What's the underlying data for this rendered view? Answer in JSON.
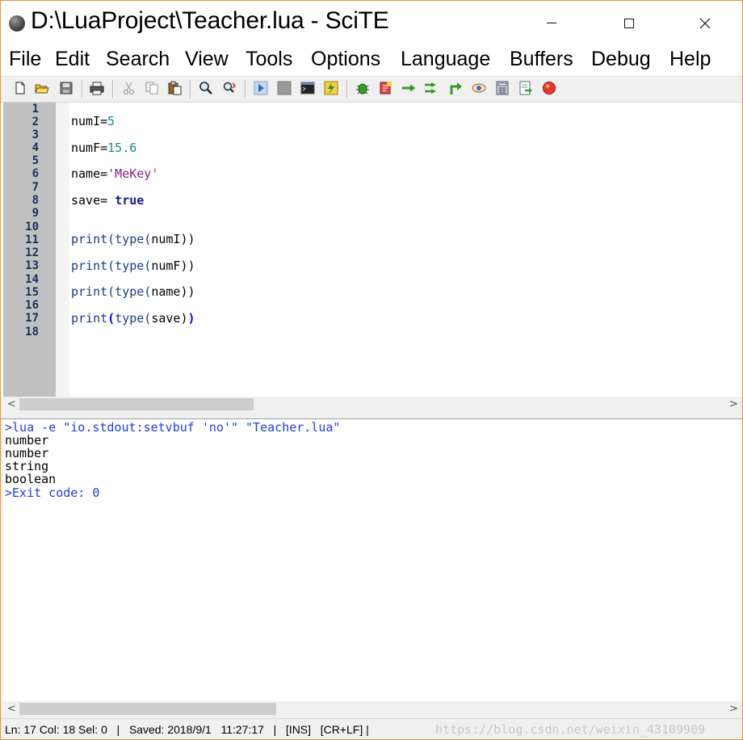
{
  "window": {
    "title": "D:\\LuaProject\\Teacher.lua - SciTE",
    "minimize_glyph": "",
    "close_glyph": "✕"
  },
  "menu": [
    "File",
    "Edit",
    "Search",
    "View",
    "Tools",
    "Options",
    "Language",
    "Buffers",
    "Debug",
    "Help"
  ],
  "toolbar_icons": [
    "new-file-icon",
    "open-folder-icon",
    "save-icon",
    "print-icon",
    "cut-icon",
    "copy-icon",
    "paste-icon",
    "find-icon",
    "replace-icon",
    "run-icon",
    "stop-icon",
    "console-icon",
    "build-icon",
    "debug-bug-icon",
    "debug-step-icon",
    "step-over-icon",
    "step-into-icon",
    "step-out-icon",
    "watch-icon",
    "calculator-icon",
    "export-icon",
    "breakpoint-icon"
  ],
  "editor": {
    "line_numbers": [
      "1",
      "2",
      "3",
      "4",
      "5",
      "6",
      "7",
      "8",
      "9",
      "10",
      "11",
      "12",
      "13",
      "14",
      "15",
      "16",
      "17",
      "18"
    ],
    "code": {
      "l2": {
        "var": "numI=",
        "val": "5"
      },
      "l4": {
        "var": "numF=",
        "val": "15.6"
      },
      "l6": {
        "var": "name=",
        "val": "'MeKey'"
      },
      "l8": {
        "var": "save= ",
        "val": "true"
      },
      "l11": {
        "fn": "print(type(",
        "arg": "numI",
        "close": "))"
      },
      "l13": {
        "fn": "print(type(",
        "arg": "numF",
        "close": "))"
      },
      "l15": {
        "fn": "print(type(",
        "arg": "name",
        "close": "))"
      },
      "l17": {
        "fn": "print",
        "open": "(",
        "fn2": "type(",
        "arg": "save",
        "close1": ")",
        "close2": ")"
      }
    }
  },
  "output": {
    "lines": [
      {
        "text": ">lua -e \"io.stdout:setvbuf 'no'\" \"Teacher.lua\"",
        "kind": "cmd"
      },
      {
        "text": "number",
        "kind": "plain"
      },
      {
        "text": "number",
        "kind": "plain"
      },
      {
        "text": "string",
        "kind": "plain"
      },
      {
        "text": "boolean",
        "kind": "plain"
      },
      {
        "text": ">Exit code: 0",
        "kind": "cmd"
      }
    ]
  },
  "scroll": {
    "left_arrow": "<",
    "right_arrow": ">"
  },
  "status": {
    "text": "Ln: 17 Col: 18 Sel: 0   |   Saved: 2018/9/1   11:27:17   |   [INS]   [CR+LF] |",
    "watermark": "https://blog.csdn.net/weixin_43109909"
  }
}
